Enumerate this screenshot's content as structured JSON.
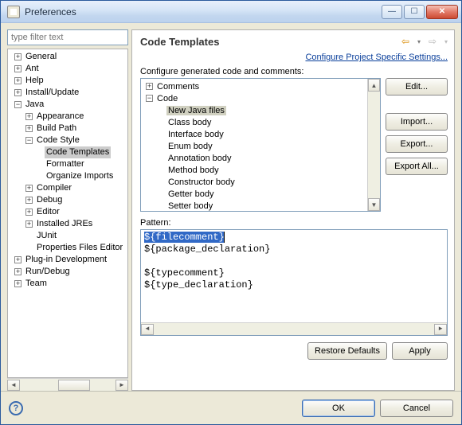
{
  "window": {
    "title": "Preferences"
  },
  "filter": {
    "placeholder": "type filter text"
  },
  "navTree": {
    "general": "General",
    "ant": "Ant",
    "help": "Help",
    "install": "Install/Update",
    "java": "Java",
    "appearance": "Appearance",
    "buildpath": "Build Path",
    "codestyle": "Code Style",
    "codetemplates": "Code Templates",
    "formatter": "Formatter",
    "organize": "Organize Imports",
    "compiler": "Compiler",
    "debug": "Debug",
    "editor": "Editor",
    "installedjres": "Installed JREs",
    "junit": "JUnit",
    "propfiles": "Properties Files Editor",
    "plugin": "Plug-in Development",
    "rundebug": "Run/Debug",
    "team": "Team"
  },
  "page": {
    "title": "Code Templates",
    "projectLink": "Configure Project Specific Settings...",
    "subtitle": "Configure generated code and comments:",
    "patternLabel": "Pattern:"
  },
  "templates": {
    "comments": "Comments",
    "code": "Code",
    "newjava": "New Java files",
    "classbody": "Class body",
    "interfacebody": "Interface body",
    "enumbody": "Enum body",
    "annotationbody": "Annotation body",
    "methodbody": "Method body",
    "constructorbody": "Constructor body",
    "getterbody": "Getter body",
    "setterbody": "Setter body"
  },
  "pattern": {
    "l1": "${filecomment}",
    "l2": "${package_declaration}",
    "l3": "${typecomment}",
    "l4": "${type_declaration}"
  },
  "buttons": {
    "edit": "Edit...",
    "import": "Import...",
    "export": "Export...",
    "exportall": "Export All...",
    "restore": "Restore Defaults",
    "apply": "Apply",
    "ok": "OK",
    "cancel": "Cancel"
  },
  "colors": {
    "navBack": "#f5a623",
    "navFwd": "#b0b0b0"
  }
}
